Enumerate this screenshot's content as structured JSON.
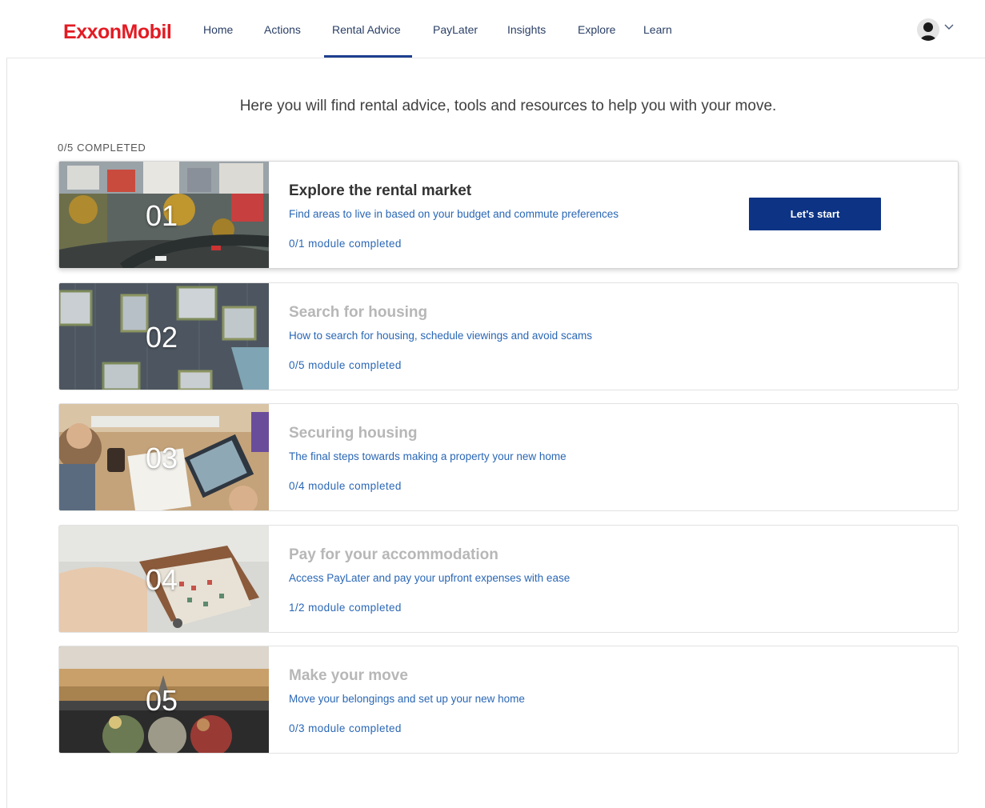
{
  "brand": {
    "logo_text_1": "E",
    "logo_text_2": "xx",
    "logo_text_3": "onMobil"
  },
  "nav": {
    "items": [
      "Home",
      "Actions",
      "Rental Advice",
      "PayLater",
      "Insights",
      "Explore",
      "Learn"
    ],
    "active": "Rental Advice"
  },
  "intro": "Here you will find rental advice, tools and resources to help you with your move.",
  "overall_progress": "0/5 COMPLETED",
  "cards": [
    {
      "number": "01",
      "title": "Explore the rental market",
      "description": "Find areas to live in based on your budget and commute preferences",
      "progress": "0/1 module completed",
      "button": "Let's start",
      "active": true
    },
    {
      "number": "02",
      "title": "Search for housing",
      "description": "How to search for housing, schedule viewings and avoid scams",
      "progress": "0/5 module completed",
      "active": false
    },
    {
      "number": "03",
      "title": "Securing housing",
      "description": "The final steps towards making a property your new home",
      "progress": "0/4 module completed",
      "active": false
    },
    {
      "number": "04",
      "title": "Pay for your accommodation",
      "description": "Access PayLater and pay your upfront expenses with ease",
      "progress": "1/2 module completed",
      "active": false
    },
    {
      "number": "05",
      "title": "Make your move",
      "description": "Move your belongings and set up your new home",
      "progress": "0/3 module completed",
      "active": false
    }
  ],
  "colors": {
    "brand_red": "#e31b23",
    "nav_text": "#2a3f66",
    "accent_blue": "#0c3384",
    "link_blue": "#2a67b5",
    "inactive_title": "#b7b7b7"
  },
  "icons": {
    "user": "avatar-icon",
    "menu": "chevron-down-icon"
  }
}
